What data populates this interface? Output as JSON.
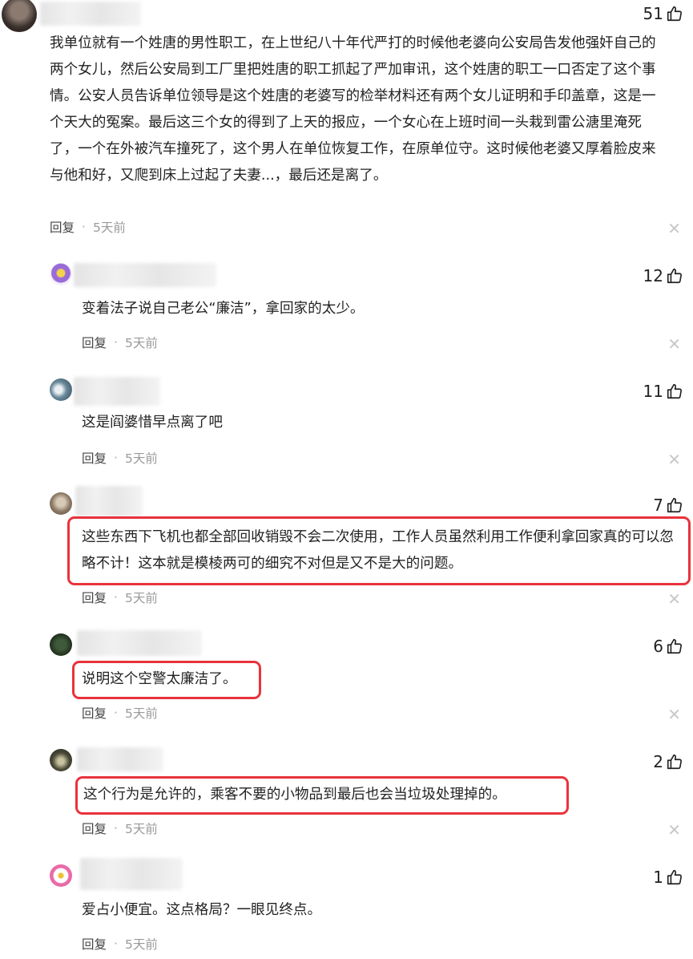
{
  "comments": [
    {
      "likes": "51",
      "text": "我单位就有一个姓唐的男性职工，在上世纪八十年代严打的时候他老婆向公安局告发他强奸自己的两个女儿，然后公安局到工厂里把姓唐的职工抓起了严加审讯，这个姓唐的职工一口否定了这个事情。公安人员告诉单位领导是这个姓唐的老婆写的检举材料还有两个女儿证明和手印盖章，这是一个天大的冤案。最后这三个女的得到了上天的报应，一个女心在上班时间一头栽到雷公溏里淹死了，一个在外被汽车撞死了，这个男人在单位恢复工作，在原单位守。这时候他老婆又厚着脸皮来与他和好，又爬到床上过起了夫妻...，最后还是离了。",
      "reply": "回复",
      "time": "5天前"
    },
    {
      "likes": "12",
      "text": "变着法子说自己老公“廉洁”，拿回家的太少。",
      "reply": "回复",
      "time": "5天前"
    },
    {
      "likes": "11",
      "text": "这是阎婆惜早点离了吧",
      "reply": "回复",
      "time": "5天前"
    },
    {
      "likes": "7",
      "text": "这些东西下飞机也都全部回收销毁不会二次使用，工作人员虽然利用工作便利拿回家真的可以忽略不计！这本就是模棱两可的细究不对但是又不是大的问题。",
      "reply": "回复",
      "time": "5天前"
    },
    {
      "likes": "6",
      "text": "说明这个空警太廉洁了。",
      "reply": "回复",
      "time": "5天前"
    },
    {
      "likes": "2",
      "text": "这个行为是允许的，乘客不要的小物品到最后也会当垃圾处理掉的。",
      "reply": "回复",
      "time": "5天前"
    },
    {
      "likes": "1",
      "text": "爱占小便宜。这点格局？一眼见终点。",
      "reply": "回复",
      "time": "5天前"
    }
  ],
  "icons": {
    "like": "thumbs-up-icon",
    "close": "close-icon"
  },
  "colors": {
    "highlight": "#e8333c",
    "meta_time": "#9a9a9a"
  }
}
